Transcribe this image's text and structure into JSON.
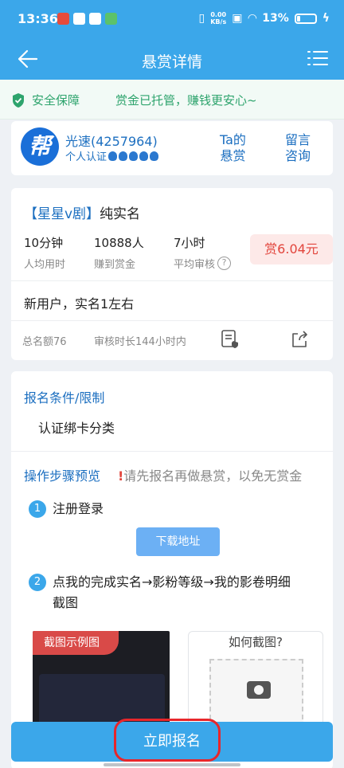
{
  "status_bar": {
    "time": "13:36",
    "net_speed_value": "0.00",
    "net_speed_unit": "KB/s",
    "battery": "13%"
  },
  "nav": {
    "title": "悬赏详情"
  },
  "safety": {
    "label": "安全保障",
    "text": "赏金已托管，赚钱更安心~"
  },
  "user": {
    "avatar_char": "帮",
    "name": "光速(4257964)",
    "cert": "个人认证",
    "link_task_line1": "Ta的",
    "link_task_line2": "悬赏",
    "link_msg_line1": "留言",
    "link_msg_line2": "咨询"
  },
  "task": {
    "tag": "【星星v剧】",
    "name": "纯实名",
    "stats": [
      {
        "value": "10分钟",
        "label": "人均用时"
      },
      {
        "value": "10888人",
        "label": "赚到赏金"
      },
      {
        "value": "7小时",
        "label": "平均审核"
      }
    ],
    "reward": "赏6.04元",
    "description": "新用户，实名1左右",
    "total_quota": "总名额76",
    "review_time": "审核时长144小时内"
  },
  "requirements": {
    "title": "报名条件/限制",
    "text": "认证绑卡分类",
    "steps_title": "操作步骤预览",
    "warning_mark": "!",
    "warning": "请先报名再做悬赏，以免无赏金",
    "steps": [
      {
        "num": "1",
        "text": "注册登录",
        "button": "下载地址"
      },
      {
        "num": "2",
        "text_line1": "点我的完成实名→影粉等级→我的影卷明细",
        "text_line2": "截图"
      }
    ],
    "example_tag": "截图示例图",
    "howto_title": "如何截图?"
  },
  "footer": {
    "signup_label": "立即报名"
  },
  "colors": {
    "primary": "#3ba7ea",
    "link": "#1c6fc0",
    "reward": "#e2453c",
    "safety": "#2ea46d",
    "annotation": "#e8262b"
  }
}
